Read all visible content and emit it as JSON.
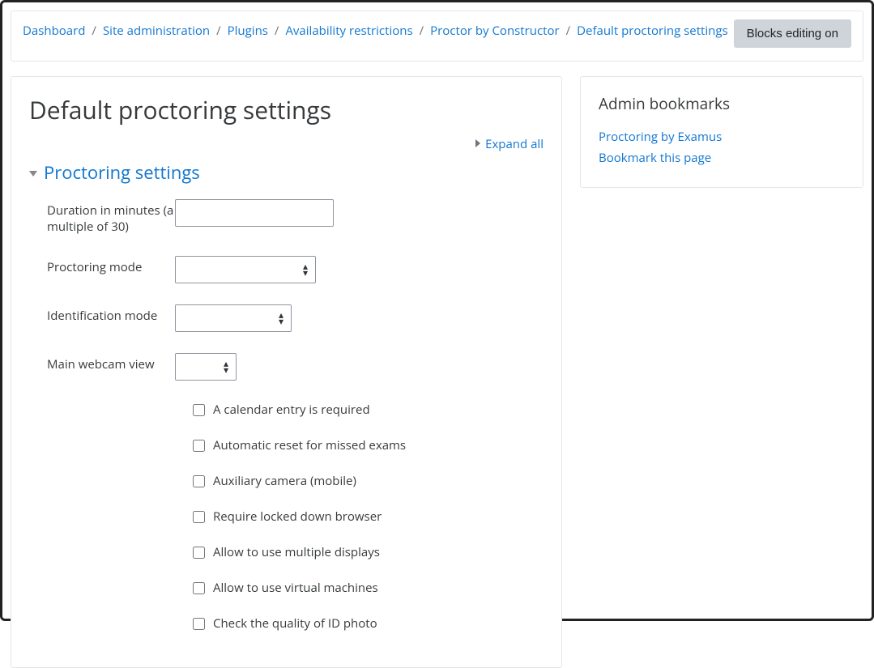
{
  "breadcrumbs": [
    "Dashboard",
    "Site administration",
    "Plugins",
    "Availability restrictions",
    "Proctor by Constructor",
    "Default proctoring settings"
  ],
  "header": {
    "blocks_editing_button": "Blocks editing on"
  },
  "main": {
    "title": "Default proctoring settings",
    "expand_all": "Expand all",
    "section_heading": "Proctoring settings",
    "fields": {
      "duration_label": "Duration in minutes (a multiple of 30)",
      "duration_value": "",
      "proctoring_mode_label": "Proctoring mode",
      "proctoring_mode_value": "",
      "identification_mode_label": "Identification mode",
      "identification_mode_value": "",
      "main_webcam_label": "Main webcam view",
      "main_webcam_value": ""
    },
    "checkboxes": [
      "A calendar entry is required",
      "Automatic reset for missed exams",
      "Auxiliary camera (mobile)",
      "Require locked down browser",
      "Allow to use multiple displays",
      "Allow to use virtual machines",
      "Check the quality of ID photo"
    ]
  },
  "sidebar": {
    "title": "Admin bookmarks",
    "links": [
      "Proctoring by Examus",
      "Bookmark this page"
    ]
  }
}
